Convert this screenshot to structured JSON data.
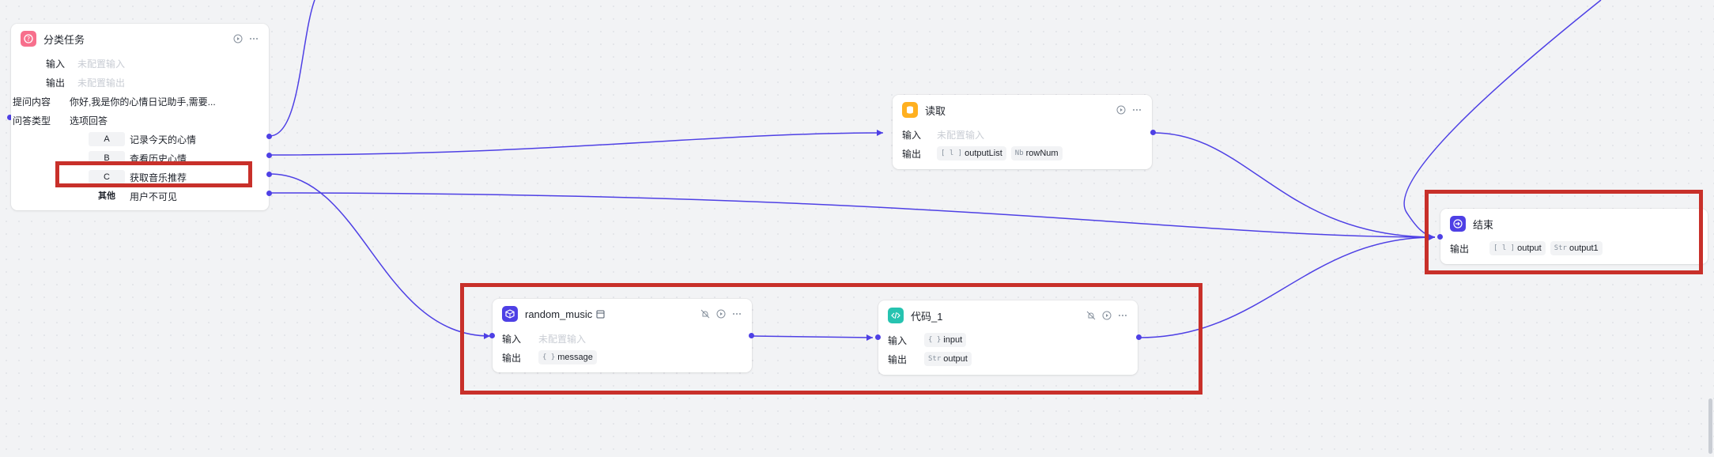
{
  "colors": {
    "edge": "#4e40e5",
    "highlight": "#c8302a",
    "port": "#4e40e5"
  },
  "classify": {
    "title": "分类任务",
    "input_label": "输入",
    "input_value": "未配置输入",
    "output_label": "输出",
    "output_value": "未配置输出",
    "prompt_label": "提问内容",
    "prompt_value": "你好,我是你的心情日记助手,需要...",
    "answer_type_label": "问答类型",
    "answer_type_value": "选项回答",
    "options": [
      {
        "key": "A",
        "text": "记录今天的心情"
      },
      {
        "key": "B",
        "text": "查看历史心情"
      },
      {
        "key": "C",
        "text": "获取音乐推荐"
      },
      {
        "key": "其他",
        "text": "用户不可见"
      }
    ]
  },
  "read": {
    "title": "读取",
    "input_label": "输入",
    "input_value": "未配置输入",
    "output_label": "输出",
    "outputs": [
      {
        "type": "[ l ]",
        "name": "outputList"
      },
      {
        "type": "Nb",
        "name": "rowNum"
      }
    ]
  },
  "end": {
    "title": "结束",
    "output_label": "输出",
    "outputs": [
      {
        "type": "[ l ]",
        "name": "output"
      },
      {
        "type": "Str",
        "name": "output1"
      }
    ]
  },
  "music": {
    "title": "random_music",
    "input_label": "输入",
    "input_value": "未配置输入",
    "output_label": "输出",
    "outputs": [
      {
        "type": "{ }",
        "name": "message"
      }
    ]
  },
  "code": {
    "title": "代码_1",
    "input_label": "输入",
    "inputs": [
      {
        "type": "{ }",
        "name": "input"
      }
    ],
    "output_label": "输出",
    "outputs": [
      {
        "type": "Str",
        "name": "output"
      }
    ]
  }
}
